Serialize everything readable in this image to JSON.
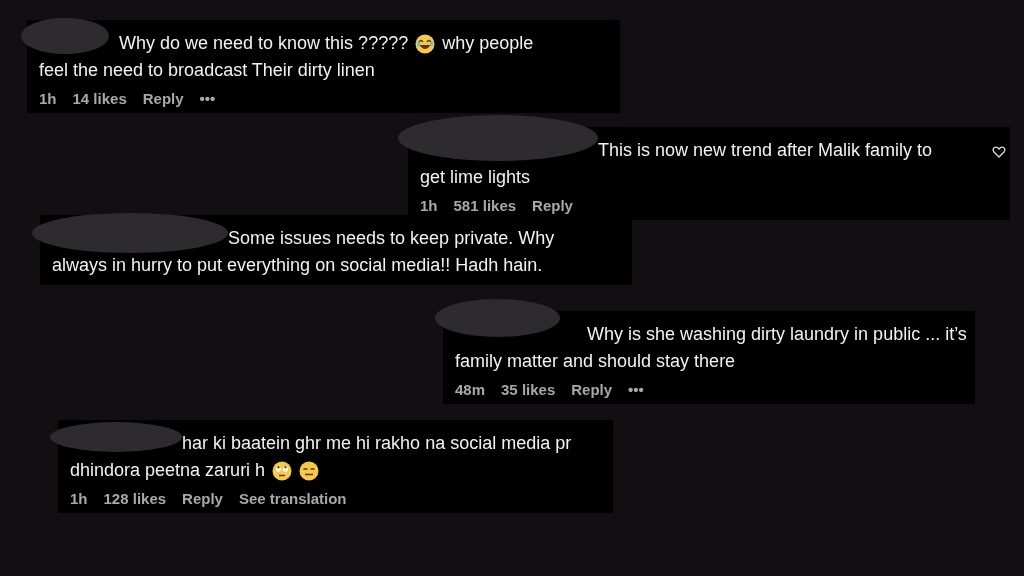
{
  "comments": [
    {
      "lines": [
        [
          {
            "kind": "text",
            "text": "Why do we need to know this ?????"
          },
          {
            "kind": "emoji"
          },
          {
            "kind": "text",
            "text": "why people"
          }
        ],
        [
          {
            "kind": "text",
            "text": "feel the need to broadcast Their dirty linen"
          }
        ]
      ],
      "meta": [
        "1h",
        "14 likes",
        "Reply",
        "•••"
      ]
    },
    {
      "lines": [
        [
          {
            "kind": "text",
            "text": "This is now new trend after Malik family to"
          }
        ],
        [
          {
            "kind": "text",
            "text": "get lime lights"
          }
        ]
      ],
      "meta": [
        "1h",
        "581 likes",
        "Reply"
      ],
      "like_button": true
    },
    {
      "lines": [
        [
          {
            "kind": "text",
            "text": "Some issues needs to keep private. Why"
          }
        ],
        [
          {
            "kind": "text",
            "text": "always in hurry to put everything on social media!! Hadh hain."
          }
        ]
      ]
    },
    {
      "lines": [
        [
          {
            "kind": "text",
            "text": "Why is she washing dirty laundry in public ... it’s"
          }
        ],
        [
          {
            "kind": "text",
            "text": "family matter and should stay there"
          }
        ]
      ],
      "meta": [
        "48m",
        "35 likes",
        "Reply",
        "•••"
      ]
    },
    {
      "lines": [
        [
          {
            "kind": "text",
            "text": "har ki baatein ghr me hi rakho na social media pr"
          }
        ],
        [
          {
            "kind": "text",
            "text": "dhindora peetna zaruri h"
          },
          {
            "kind": "emoji"
          },
          {
            "kind": "emoji"
          }
        ]
      ],
      "meta": [
        "1h",
        "128 likes",
        "Reply",
        "See translation"
      ]
    }
  ]
}
